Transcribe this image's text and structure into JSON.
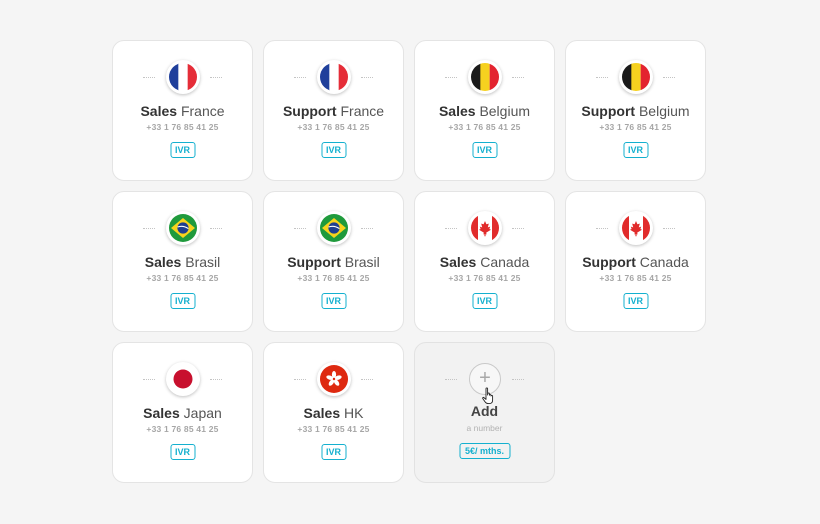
{
  "cards": [
    {
      "name": "Sales",
      "location": "France",
      "phone": "+33 1 76 85 41 25",
      "badge": "IVR",
      "flag": "france-flag-icon"
    },
    {
      "name": "Support",
      "location": "France",
      "phone": "+33 1 76 85 41 25",
      "badge": "IVR",
      "flag": "france-flag-icon"
    },
    {
      "name": "Sales",
      "location": "Belgium",
      "phone": "+33 1 76 85 41 25",
      "badge": "IVR",
      "flag": "belgium-flag-icon"
    },
    {
      "name": "Support",
      "location": "Belgium",
      "phone": "+33 1 76 85 41 25",
      "badge": "IVR",
      "flag": "belgium-flag-icon"
    },
    {
      "name": "Sales",
      "location": "Brasil",
      "phone": "+33 1 76 85 41 25",
      "badge": "IVR",
      "flag": "brazil-flag-icon"
    },
    {
      "name": "Support",
      "location": "Brasil",
      "phone": "+33 1 76 85 41 25",
      "badge": "IVR",
      "flag": "brazil-flag-icon"
    },
    {
      "name": "Sales",
      "location": "Canada",
      "phone": "+33 1 76 85 41 25",
      "badge": "IVR",
      "flag": "canada-flag-icon"
    },
    {
      "name": "Support",
      "location": "Canada",
      "phone": "+33 1 76 85 41 25",
      "badge": "IVR",
      "flag": "canada-flag-icon"
    },
    {
      "name": "Sales",
      "location": "Japan",
      "phone": "+33 1 76 85 41 25",
      "badge": "IVR",
      "flag": "japan-flag-icon"
    },
    {
      "name": "Sales",
      "location": "HK",
      "phone": "+33 1 76 85 41 25",
      "badge": "IVR",
      "flag": "hong-kong-flag-icon"
    }
  ],
  "add_card": {
    "title": "Add",
    "subtitle": "a number",
    "price": "5€/ mths."
  },
  "colors": {
    "accent": "#14b0cf",
    "card_background": "#ffffff",
    "page_background": "#f5f5f5"
  }
}
